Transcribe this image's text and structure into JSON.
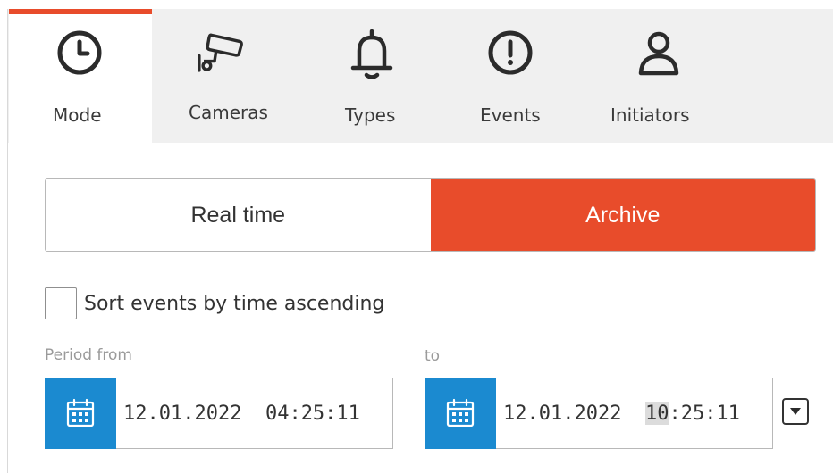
{
  "tabs": [
    {
      "label": "Mode",
      "icon": "clock-icon"
    },
    {
      "label": "Cameras",
      "icon": "camera-icon"
    },
    {
      "label": "Types",
      "icon": "bell-icon"
    },
    {
      "label": "Events",
      "icon": "alert-icon"
    },
    {
      "label": "Initiators",
      "icon": "user-icon"
    }
  ],
  "mode": {
    "realtime_label": "Real time",
    "archive_label": "Archive",
    "selected": "Archive"
  },
  "sort": {
    "label": "Sort events by time ascending",
    "checked": false
  },
  "period": {
    "from_label": "Period from",
    "to_label": "to",
    "from_date": "12.01.2022",
    "from_time": "04:25:11",
    "to_date": "12.01.2022",
    "to_time_hour": "10",
    "to_time_rest": ":25:11"
  },
  "colors": {
    "accent": "#e84c2b",
    "calendar": "#1b8ad0"
  }
}
